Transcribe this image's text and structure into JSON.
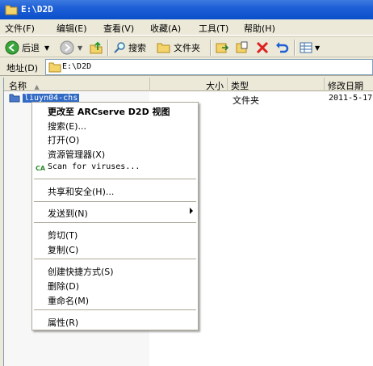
{
  "window": {
    "title": "E:\\D2D"
  },
  "menubar": [
    "文件(F)",
    "编辑(E)",
    "查看(V)",
    "收藏(A)",
    "工具(T)",
    "帮助(H)"
  ],
  "toolbar": {
    "back": "后退",
    "search": "搜索",
    "folders": "文件夹"
  },
  "address": {
    "label": "地址(D)",
    "value": "E:\\D2D"
  },
  "columns": {
    "name": "名称",
    "size": "大小",
    "type": "类型",
    "modified": "修改日期"
  },
  "files": [
    {
      "name": "liuyn04-chs",
      "type": "文件夹",
      "modified": "2011-5-17"
    }
  ],
  "context_menu": {
    "items": [
      "更改至 ARCserve D2D 视图",
      "搜索(E)...",
      "打开(O)",
      "资源管理器(X)",
      "Scan for viruses...",
      "共享和安全(H)...",
      "发送到(N)",
      "剪切(T)",
      "复制(C)",
      "创建快捷方式(S)",
      "删除(D)",
      "重命名(M)",
      "属性(R)"
    ],
    "scan_icon": "CA"
  }
}
